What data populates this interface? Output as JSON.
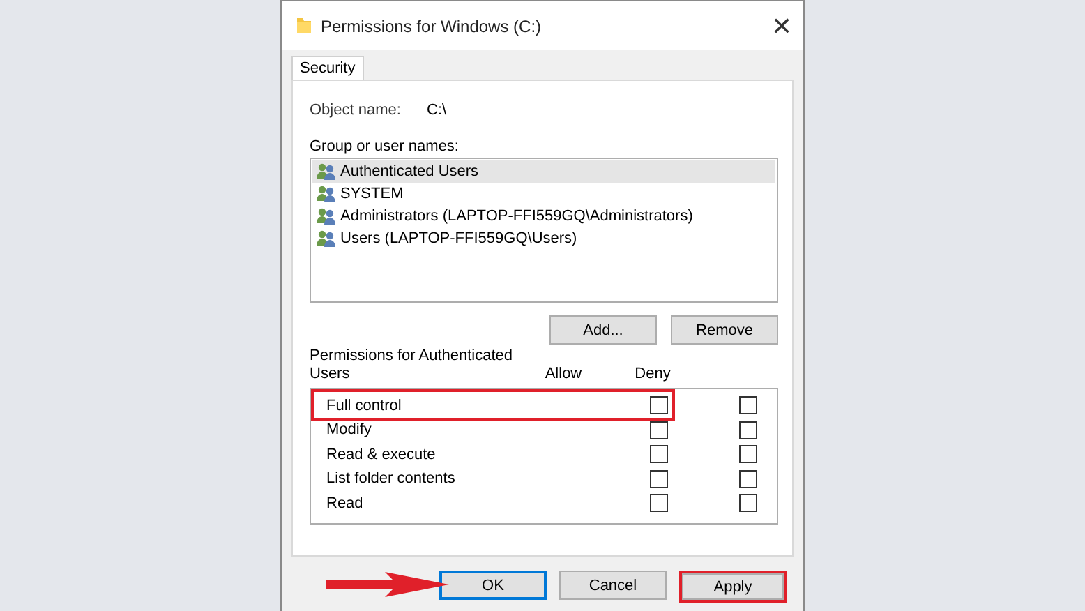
{
  "window": {
    "title": "Permissions for Windows (C:)",
    "close": "✕"
  },
  "tabs": [
    {
      "label": "Security",
      "selected": true
    }
  ],
  "object_name": {
    "label": "Object name:",
    "value": "C:\\"
  },
  "group_label": "Group or user names:",
  "users": [
    {
      "name": "Authenticated Users",
      "selected": true
    },
    {
      "name": "SYSTEM",
      "selected": false
    },
    {
      "name": "Administrators (LAPTOP-FFI559GQ\\Administrators)",
      "selected": false
    },
    {
      "name": "Users (LAPTOP-FFI559GQ\\Users)",
      "selected": false
    }
  ],
  "user_buttons": [
    "Add...",
    "Remove"
  ],
  "permissions": {
    "title": "Permissions for Authenticated Users",
    "columns": [
      "Allow",
      "Deny"
    ],
    "rows": [
      {
        "name": "Full control",
        "allow": false,
        "deny": false
      },
      {
        "name": "Modify",
        "allow": false,
        "deny": false
      },
      {
        "name": "Read & execute",
        "allow": false,
        "deny": false
      },
      {
        "name": "List folder contents",
        "allow": false,
        "deny": false
      },
      {
        "name": "Read",
        "allow": false,
        "deny": false
      }
    ]
  },
  "dialog_buttons": [
    {
      "label": "OK",
      "default": true
    },
    {
      "label": "Cancel",
      "default": false
    },
    {
      "label": "Apply",
      "default": false
    }
  ]
}
